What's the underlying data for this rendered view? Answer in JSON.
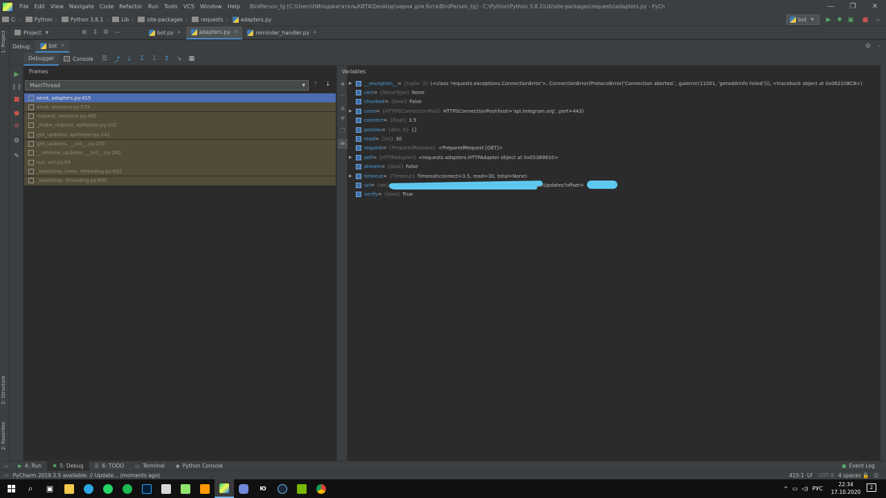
{
  "menu": [
    "File",
    "Edit",
    "View",
    "Navigate",
    "Code",
    "Refactor",
    "Run",
    "Tools",
    "VCS",
    "Window",
    "Help"
  ],
  "window_title": "BirdPerson_tg [C:\\Users\\НИподжигательКИТА\\Desktop\\херня для бота\\BirdPerson_tg] - C:\\Python\\Python 3.8.1\\Lib\\site-packages\\requests\\adapters.py - PyCharm",
  "breadcrumbs": [
    "C:",
    "Python",
    "Python 3.8.1",
    "Lib",
    "site-packages",
    "requests",
    "adapters.py"
  ],
  "run_config": "bot",
  "editor_tabs": [
    {
      "label": "Project"
    },
    {
      "label": "bot.py"
    },
    {
      "label": "adapters.py"
    },
    {
      "label": "reminder_handler.py"
    }
  ],
  "debug": {
    "label": "Debug:",
    "session": "bot"
  },
  "debug_tabs": {
    "debugger": "Debugger",
    "console": "Console"
  },
  "frames": {
    "header": "Frames",
    "thread": "MainThread",
    "items": [
      "send, adapters.py:415",
      "send, sessions.py:573",
      "request, sessions.py:465",
      "_make_request, apihelper.py:102",
      "get_updates, apihelper.py:241",
      "get_updates, __init__.py:255",
      "__retrieve_updates, __init__.py:285",
      "run, util.py:69",
      "_bootstrap_inner, threading.py:932",
      "_bootstrap, threading.py:890"
    ]
  },
  "variables": {
    "header": "Variables",
    "items": [
      {
        "name": "__exception__",
        "type": "{tuple: 3}",
        "value": "(<class 'requests.exceptions.ConnectionError'>, ConnectionError(ProtocolError('Connection aborted.', gaierror(11001, 'getaddrinfo failed'))), <traceback object at 0x062108C8>)"
      },
      {
        "name": "cert",
        "type": "{NoneType}",
        "value": "None"
      },
      {
        "name": "chunked",
        "type": "{bool}",
        "value": "False"
      },
      {
        "name": "conn",
        "type": "{HTTPSConnectionPool}",
        "value": "HTTPSConnectionPool(host='api.telegram.org', port=443)"
      },
      {
        "name": "connect",
        "type": "{float}",
        "value": "3.5"
      },
      {
        "name": "proxies",
        "type": "{dict: 0}",
        "value": "{}"
      },
      {
        "name": "read",
        "type": "{int}",
        "value": "30"
      },
      {
        "name": "request",
        "type": "{PreparedRequest}",
        "value": "<PreparedRequest [GET]>"
      },
      {
        "name": "self",
        "type": "{HTTPAdapter}",
        "value": "<requests.adapters.HTTPAdapter object at 0x05389910>"
      },
      {
        "name": "stream",
        "type": "{bool}",
        "value": "False"
      },
      {
        "name": "timeout",
        "type": "{Timeout}",
        "value": "Timeout(connect=3.5, read=30, total=None)"
      },
      {
        "name": "url",
        "type": "{str}",
        "value": "/getUpdates?offset="
      },
      {
        "name": "verify",
        "type": "{bool}",
        "value": "True"
      }
    ]
  },
  "left_tabs": {
    "project": "1: Project",
    "structure": "2: Structure",
    "favorites": "2: Favorites"
  },
  "bottom_tabs": [
    "4: Run",
    "5: Debug",
    "6: TODO",
    "Terminal",
    "Python Console"
  ],
  "event_log": "Event Log",
  "status": {
    "message": "PyCharm 2019.3.5 available: // Update... (moments ago)",
    "position": "415:1",
    "line_sep": "LF",
    "encoding": "UTF-8",
    "indent": "4 spaces"
  },
  "taskbar": {
    "lang": "РУС",
    "time": "22:34",
    "date": "17.10.2020",
    "notif": "2"
  },
  "colors": {
    "accent": "#4a88c7",
    "selection": "#4c6cb0",
    "frame_bg": "#524b37",
    "var_name": "#4a9edb"
  }
}
